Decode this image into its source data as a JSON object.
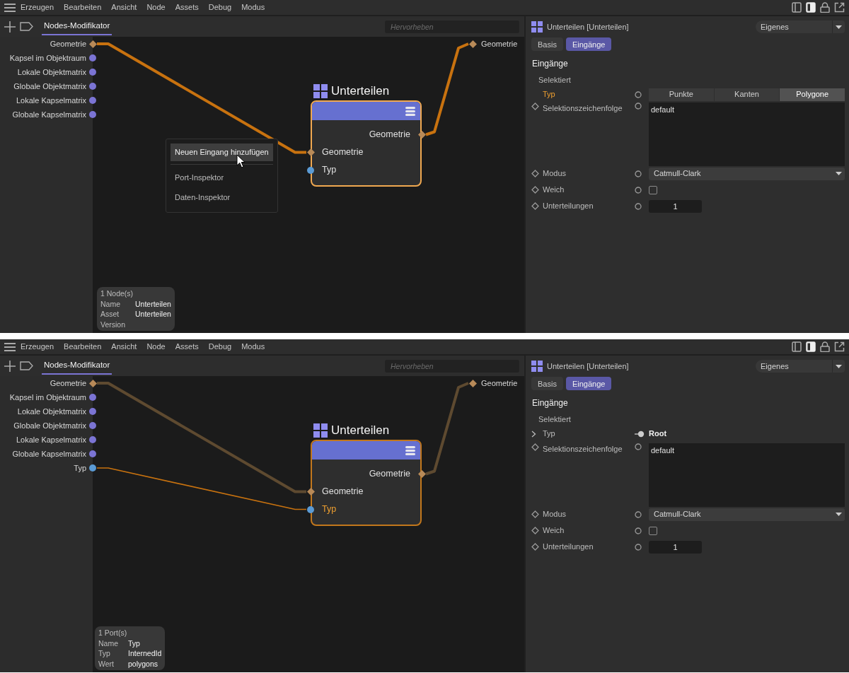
{
  "panels": [
    {
      "menu_bar": {
        "items": [
          "Erzeugen",
          "Bearbeiten",
          "Ansicht",
          "Node",
          "Assets",
          "Debug",
          "Modus"
        ]
      },
      "toolbar": {
        "tabs": [
          {
            "label": "Nodes-Modifikator",
            "selected": true
          }
        ],
        "search": {
          "placeholder": "Hervorheben"
        }
      },
      "graph": {
        "inputs": [
          {
            "label": "Geometrie",
            "kind": "diamond",
            "color": "#b88a58"
          },
          {
            "label": "Kapsel im Objektraum",
            "kind": "dot",
            "color": "#7b74d4"
          },
          {
            "label": "Lokale Objektmatrix",
            "kind": "dot",
            "color": "#7b74d4"
          },
          {
            "label": "Globale Objektmatrix",
            "kind": "dot",
            "color": "#7b74d4"
          },
          {
            "label": "Lokale Kapselmatrix",
            "kind": "dot",
            "color": "#7b74d4"
          },
          {
            "label": "Globale Kapselmatrix",
            "kind": "dot",
            "color": "#7b74d4"
          }
        ],
        "outputs": [
          {
            "label": "Geometrie",
            "kind": "diamond",
            "color": "#b88a58"
          }
        ],
        "node": {
          "title": "Unterteilen",
          "selected": true,
          "outputs": [
            {
              "label": "Geometrie",
              "kind": "diamond",
              "color": "#b88a58",
              "linked": true,
              "wire_active": true
            }
          ],
          "inputs": [
            {
              "label": "Geometrie",
              "kind": "diamond",
              "color": "#b88a58",
              "selected": false,
              "linked": true,
              "wire_active": true
            },
            {
              "label": "Typ",
              "kind": "dot",
              "color": "#5b9bd5",
              "selected": false,
              "linked": false
            }
          ]
        },
        "context_menu": {
          "items": [
            {
              "label": "Neuen Eingang hinzufügen",
              "selected": true,
              "hovered": true,
              "divider_after": true
            },
            {
              "label": "Port-Inspektor",
              "selected": false,
              "hovered": false,
              "divider_after": false
            },
            {
              "label": "Daten-Inspektor",
              "selected": false,
              "hovered": false,
              "divider_after": false
            }
          ]
        },
        "info": {
          "title": "1 Node(s)",
          "rows": [
            {
              "key": "Name",
              "value": "Unterteilen"
            },
            {
              "key": "Asset",
              "value": "Unterteilen"
            },
            {
              "key": "Version"
            }
          ]
        }
      },
      "inspector": {
        "title": "Unterteilen [Unterteilen]",
        "preset": "Eigenes",
        "tabs": [
          {
            "label": "Basis",
            "selected": false
          },
          {
            "label": "Eingänge",
            "selected": true
          }
        ],
        "section": "Eingänge",
        "group": "Selektiert",
        "rows": [
          {
            "kind": "segmented",
            "keyframe": false,
            "expandable": false,
            "label": "Typ",
            "active": true,
            "port_connected": false,
            "options": [
              {
                "label": "Punkte",
                "selected": false
              },
              {
                "label": "Kanten",
                "selected": false
              },
              {
                "label": "Polygone",
                "selected": true
              }
            ]
          },
          {
            "kind": "textarea",
            "keyframe": true,
            "expandable": false,
            "label": "Selektionszeichenfolge",
            "active": false,
            "port_connected": false,
            "value": "default"
          },
          {
            "kind": "dropdown",
            "keyframe": true,
            "expandable": false,
            "label": "Modus",
            "active": false,
            "port_connected": false,
            "value": "Catmull-Clark"
          },
          {
            "kind": "checkbox",
            "keyframe": true,
            "expandable": false,
            "label": "Weich",
            "active": false,
            "port_connected": false,
            "checked": false
          },
          {
            "kind": "number",
            "keyframe": true,
            "expandable": false,
            "label": "Unterteilungen",
            "active": false,
            "port_connected": false,
            "value": "1"
          }
        ]
      }
    },
    {
      "menu_bar": {
        "items": [
          "Erzeugen",
          "Bearbeiten",
          "Ansicht",
          "Node",
          "Assets",
          "Debug",
          "Modus"
        ]
      },
      "toolbar": {
        "tabs": [
          {
            "label": "Nodes-Modifikator",
            "selected": true
          }
        ],
        "search": {
          "placeholder": "Hervorheben"
        }
      },
      "graph": {
        "inputs": [
          {
            "label": "Geometrie",
            "kind": "diamond",
            "color": "#b88a58"
          },
          {
            "label": "Kapsel im Objektraum",
            "kind": "dot",
            "color": "#7b74d4"
          },
          {
            "label": "Lokale Objektmatrix",
            "kind": "dot",
            "color": "#7b74d4"
          },
          {
            "label": "Globale Objektmatrix",
            "kind": "dot",
            "color": "#7b74d4"
          },
          {
            "label": "Lokale Kapselmatrix",
            "kind": "dot",
            "color": "#7b74d4"
          },
          {
            "label": "Globale Kapselmatrix",
            "kind": "dot",
            "color": "#7b74d4"
          },
          {
            "label": "Typ",
            "kind": "dot",
            "color": "#5b9bd5"
          }
        ],
        "outputs": [
          {
            "label": "Geometrie",
            "kind": "diamond",
            "color": "#b88a58"
          }
        ],
        "node": {
          "title": "Unterteilen",
          "selected": false,
          "outputs": [
            {
              "label": "Geometrie",
              "kind": "diamond",
              "color": "#b88a58",
              "linked": true,
              "wire_active": false
            }
          ],
          "inputs": [
            {
              "label": "Geometrie",
              "kind": "diamond",
              "color": "#b88a58",
              "selected": false,
              "linked": true,
              "wire_active": false
            },
            {
              "label": "Typ",
              "kind": "dot",
              "color": "#5b9bd5",
              "selected": true,
              "linked": true,
              "wire_active": true
            }
          ]
        },
        "info": {
          "title": "1 Port(s)",
          "rows": [
            {
              "key": "Name",
              "value": "Typ"
            },
            {
              "key": "Typ",
              "value": "InternedId"
            },
            {
              "key": "Wert",
              "value": "polygons"
            }
          ]
        }
      },
      "inspector": {
        "title": "Unterteilen [Unterteilen]",
        "preset": "Eigenes",
        "tabs": [
          {
            "label": "Basis",
            "selected": false
          },
          {
            "label": "Eingänge",
            "selected": true
          }
        ],
        "section": "Eingänge",
        "group": "Selektiert",
        "rows": [
          {
            "kind": "link",
            "keyframe": false,
            "expandable": true,
            "label": "Typ",
            "active": false,
            "port_connected": true,
            "value": "Root"
          },
          {
            "kind": "textarea",
            "keyframe": true,
            "expandable": false,
            "label": "Selektionszeichenfolge",
            "active": false,
            "port_connected": false,
            "value": "default"
          },
          {
            "kind": "dropdown",
            "keyframe": true,
            "expandable": false,
            "label": "Modus",
            "active": false,
            "port_connected": false,
            "value": "Catmull-Clark"
          },
          {
            "kind": "checkbox",
            "keyframe": true,
            "expandable": false,
            "label": "Weich",
            "active": false,
            "port_connected": false,
            "checked": false
          },
          {
            "kind": "number",
            "keyframe": true,
            "expandable": false,
            "label": "Unterteilungen",
            "active": false,
            "port_connected": false,
            "value": "1"
          }
        ]
      }
    }
  ]
}
